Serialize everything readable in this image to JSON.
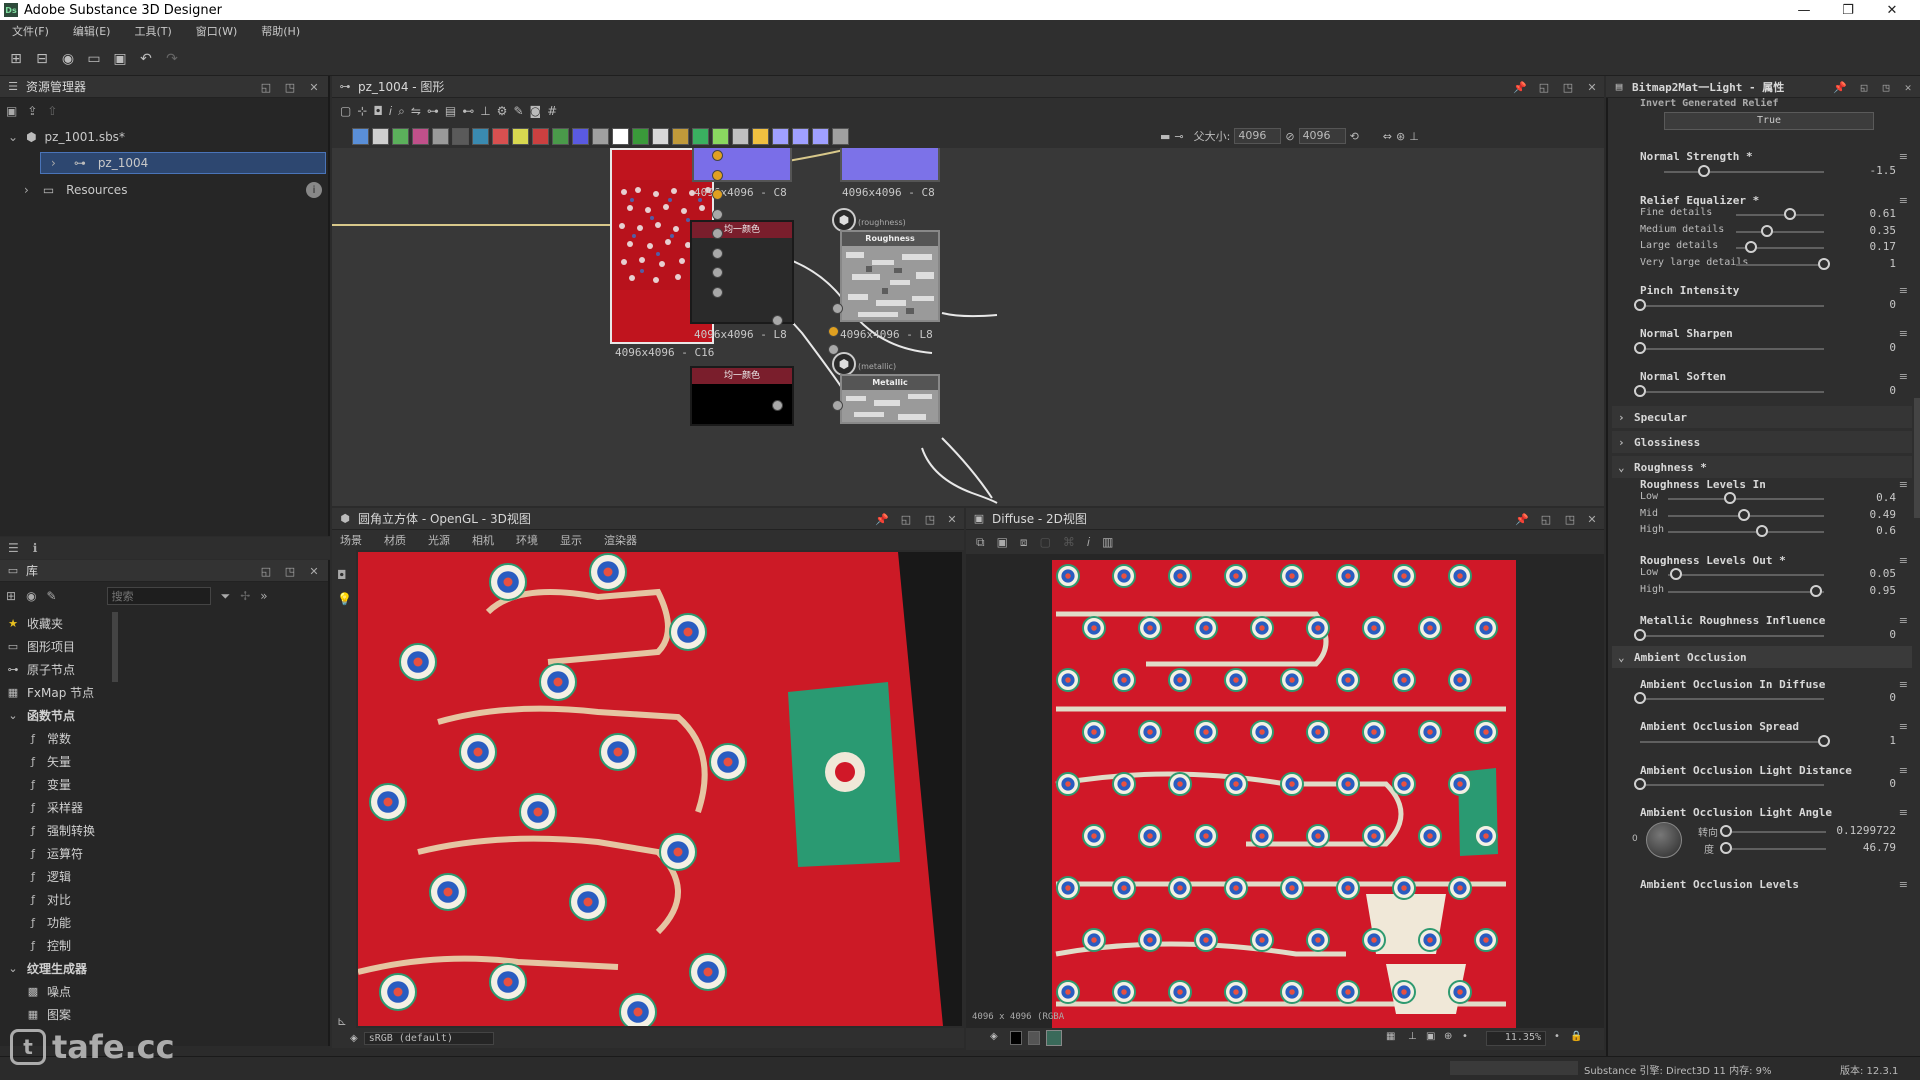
{
  "app": {
    "title": "Adobe Substance 3D Designer",
    "logo": "Ds"
  },
  "menu": [
    "文件(F)",
    "编辑(E)",
    "工具(T)",
    "窗口(W)",
    "帮助(H)"
  ],
  "explorer": {
    "title": "资源管理器",
    "package": "pz_1001.sbs*",
    "graph": "pz_1004",
    "folder": "Resources"
  },
  "library": {
    "title": "库",
    "search_placeholder": "搜索",
    "items": [
      {
        "label": "收藏夹",
        "icon": "star-icon",
        "indent": 0
      },
      {
        "label": "图形项目",
        "icon": "graph-item-icon",
        "indent": 0
      },
      {
        "label": "原子节点",
        "icon": "atomic-node-icon",
        "indent": 0
      },
      {
        "label": "FxMap 节点",
        "icon": "fxmap-icon",
        "indent": 0
      },
      {
        "label": "函数节点",
        "icon": "chevron-down-icon",
        "indent": 0,
        "bold": true
      },
      {
        "label": "常数",
        "icon": "function-icon",
        "indent": 1
      },
      {
        "label": "矢量",
        "icon": "function-icon",
        "indent": 1
      },
      {
        "label": "变量",
        "icon": "function-icon",
        "indent": 1
      },
      {
        "label": "采样器",
        "icon": "function-icon",
        "indent": 1
      },
      {
        "label": "强制转换",
        "icon": "function-icon",
        "indent": 1
      },
      {
        "label": "运算符",
        "icon": "function-icon",
        "indent": 1
      },
      {
        "label": "逻辑",
        "icon": "function-icon",
        "indent": 1
      },
      {
        "label": "对比",
        "icon": "function-icon",
        "indent": 1
      },
      {
        "label": "功能",
        "icon": "function-icon",
        "indent": 1
      },
      {
        "label": "控制",
        "icon": "function-icon",
        "indent": 1
      },
      {
        "label": "纹理生成器",
        "icon": "chevron-down-icon",
        "indent": 0,
        "bold": true
      },
      {
        "label": "噪点",
        "icon": "noise-icon",
        "indent": 1
      },
      {
        "label": "图案",
        "icon": "pattern-icon",
        "indent": 1
      }
    ]
  },
  "graph": {
    "title": "pz_1004 - 图形",
    "parent_size_label": "父大小:",
    "size_w": "4096",
    "size_h": "4096",
    "nodes": {
      "source_label": "4096x4096 - C16",
      "top1_label": "4096x4096 - C8",
      "top2_label": "4096x4096 - C8",
      "gray1_title": "均一颜色",
      "gray1_label": "4096x4096 - L8",
      "rough_tag": "(roughness)",
      "rough_title": "Roughness",
      "rough_label": "4096x4096 - L8",
      "gray2_title": "均一颜色",
      "metal_tag": "(metallic)",
      "metal_title": "Metallic"
    }
  },
  "view3d": {
    "title": "圆角立方体 - OpenGL - 3D视图",
    "menu": [
      "场景",
      "材质",
      "光源",
      "相机",
      "环境",
      "显示",
      "渲染器"
    ],
    "colorspace": "sRGB (default)"
  },
  "view2d": {
    "title": "Diffuse - 2D视图",
    "resolution": "4096 x 4096 (RGBA",
    "zoom": "11.35%"
  },
  "props": {
    "title": "Bitmap2Mat一Light - 属性",
    "top_cut": "Invert Generated Relief",
    "invert_value": "True",
    "normal_strength": {
      "label": "Normal Strength *",
      "value": "-1.5",
      "fraction": 0.25
    },
    "relief_equalizer": {
      "label": "Relief Equalizer *",
      "rows": [
        {
          "label": "Fine details",
          "value": "0.61",
          "fraction": 0.61
        },
        {
          "label": "Medium details",
          "value": "0.35",
          "fraction": 0.35
        },
        {
          "label": "Large details",
          "value": "0.17",
          "fraction": 0.17
        },
        {
          "label": "Very large details",
          "value": "1",
          "fraction": 1
        }
      ]
    },
    "pinch": {
      "label": "Pinch Intensity",
      "value": "0",
      "fraction": 0
    },
    "sharpen": {
      "label": "Normal Sharpen",
      "value": "0",
      "fraction": 0
    },
    "soften": {
      "label": "Normal Soften",
      "value": "0",
      "fraction": 0
    },
    "sections": {
      "specular": "Specular",
      "glossiness": "Glossiness",
      "roughness": "Roughness *",
      "ao": "Ambient Occlusion"
    },
    "levels_in": {
      "label": "Roughness Levels In",
      "rows": [
        {
          "label": "Low",
          "value": "0.4",
          "fraction": 0.4
        },
        {
          "label": "Mid",
          "value": "0.49",
          "fraction": 0.49
        },
        {
          "label": "High",
          "value": "0.6",
          "fraction": 0.6
        }
      ]
    },
    "levels_out": {
      "label": "Roughness Levels Out *",
      "rows": [
        {
          "label": "Low",
          "value": "0.05",
          "fraction": 0.05
        },
        {
          "label": "High",
          "value": "0.95",
          "fraction": 0.95
        }
      ]
    },
    "metallic_influence": {
      "label": "Metallic Roughness Influence",
      "value": "0",
      "fraction": 0
    },
    "ao_diffuse": {
      "label": "Ambient Occlusion In Diffuse",
      "value": "0",
      "fraction": 0
    },
    "ao_spread": {
      "label": "Ambient Occlusion Spread",
      "value": "1",
      "fraction": 1
    },
    "ao_light_distance": {
      "label": "Ambient Occlusion Light Distance",
      "value": "0",
      "fraction": 0
    },
    "ao_light_angle": {
      "label": "Ambient Occlusion Light Angle",
      "dial_value": "0",
      "dir_label": "转向",
      "dir_value": "0.1299722",
      "deg_label": "度",
      "deg_value": "46.79"
    },
    "ao_levels": "Ambient Occlusion Levels"
  },
  "status": {
    "watermark": "tafe.cc",
    "engine": "Substance 引擎: Direct3D 11 内存: 9%",
    "version": "版本: 12.3.1"
  },
  "colors": {
    "accent": "#3a78c8",
    "graph_bg": "#383838",
    "fabric_red": "#d01828",
    "fabric_green": "#2ea07a"
  }
}
